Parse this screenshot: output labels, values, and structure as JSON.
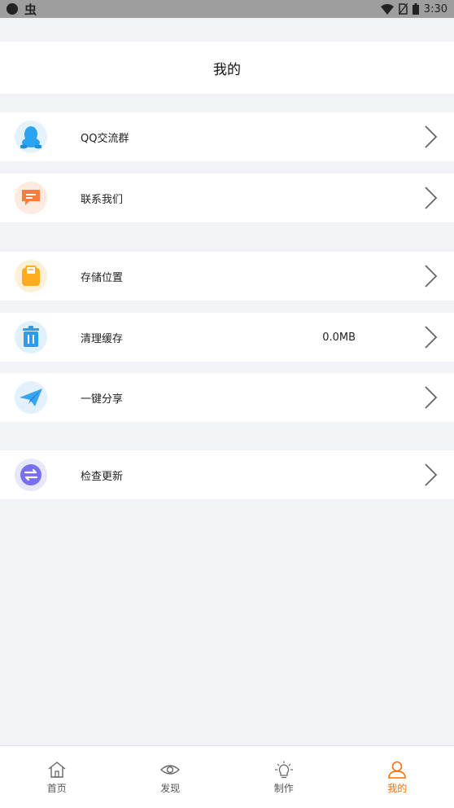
{
  "status_bar": {
    "time": "3:30",
    "notification_glyph": "虫"
  },
  "header": {
    "title": "我的"
  },
  "menu": {
    "qq_group": {
      "label": "QQ交流群",
      "icon": "qq-penguin-icon"
    },
    "contact_us": {
      "label": "联系我们",
      "icon": "chat-bubble-icon"
    },
    "storage_location": {
      "label": "存储位置",
      "icon": "storage-icon"
    },
    "clear_cache": {
      "label": "清理缓存",
      "value": "0.0MB",
      "icon": "trash-icon"
    },
    "share": {
      "label": "一键分享",
      "icon": "paper-plane-icon"
    },
    "check_update": {
      "label": "检查更新",
      "icon": "refresh-arrows-icon"
    }
  },
  "tabbar": {
    "home": "首页",
    "discover": "发现",
    "create": "制作",
    "mine": "我的"
  },
  "colors": {
    "accent": "#ff6a00",
    "background": "#f2f3f7"
  }
}
